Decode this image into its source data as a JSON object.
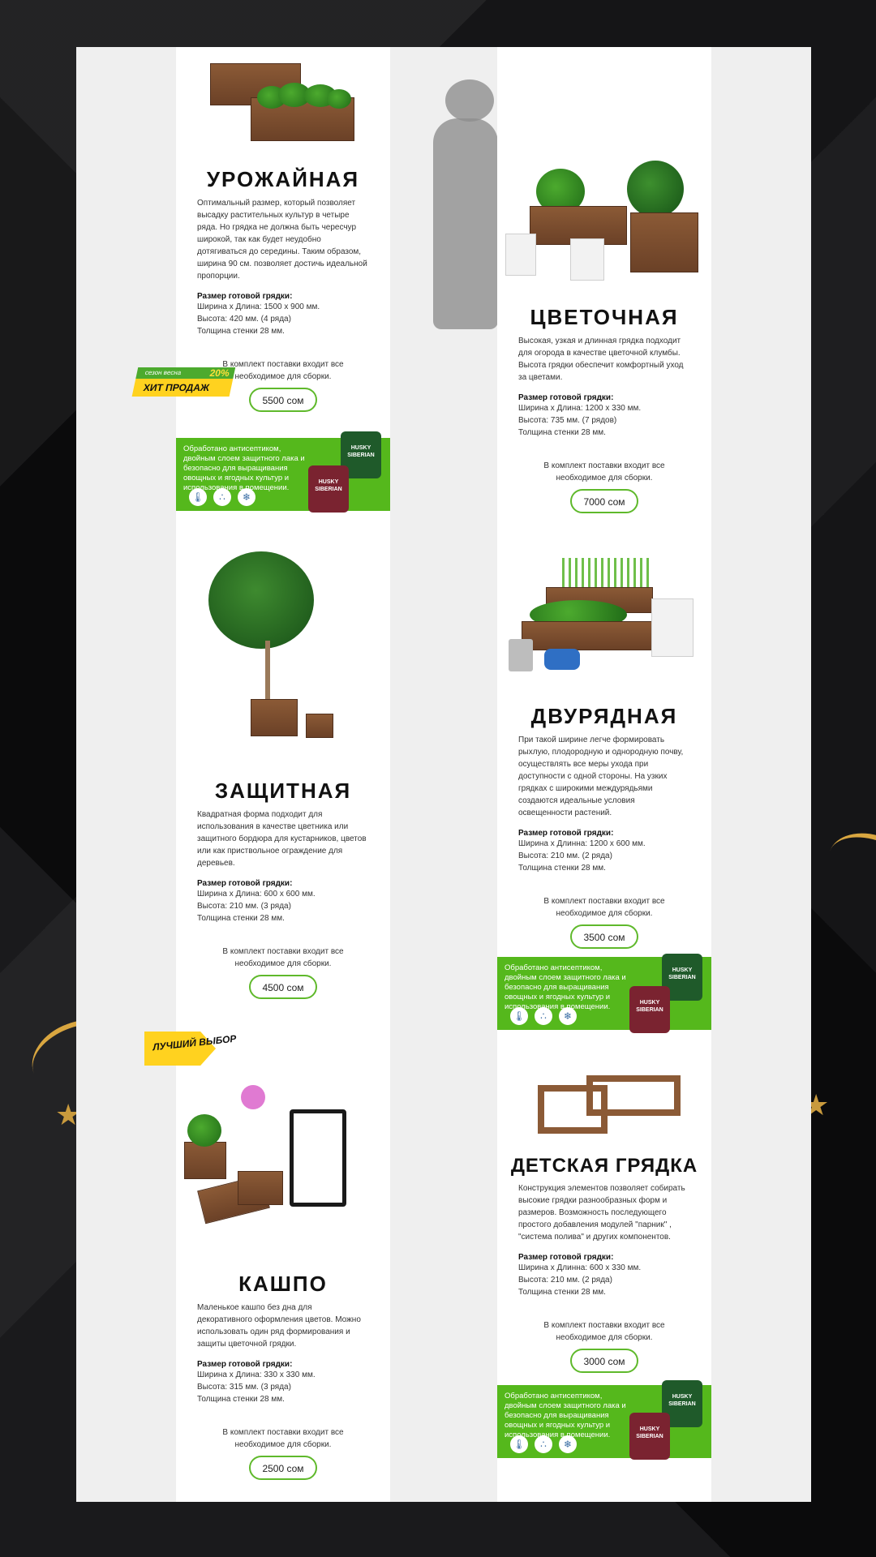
{
  "products": [
    {
      "title": "УРОЖАЙНАЯ",
      "desc": "Оптимальный размер, который позволяет высадку растительных культур в четыре ряда. Но грядка не должна быть чересчур широкой, так как будет неудобно дотягиваться до середины. Таким образом, ширина 90 см. позволяет достичь идеальной пропорции.",
      "size_head": "Размер готовой грядки:",
      "size1": "Ширина х Длина: 1500 х 900 мм.",
      "size2": "Высота: 420 мм. (4 ряда)",
      "size3": "Толщина стенки 28 мм.",
      "kit": "В комплект поставки входит все необходимое для сборки.",
      "price": "5500 сом"
    },
    {
      "title": "ЦВЕТОЧНАЯ",
      "desc": "Высокая, узкая и длинная грядка подходит для огорода в качестве цветочной клумбы. Высота грядки обеспечит комфортный уход за цветами.",
      "size_head": "Размер готовой грядки:",
      "size1": "Ширина х Длина: 1200 х 330 мм.",
      "size2": "Высота: 735 мм. (7 рядов)",
      "size3": "Толщина стенки 28 мм.",
      "kit": "В комплект поставки входит все необходимое для сборки.",
      "price": "7000 сом"
    },
    {
      "title": "ЗАЩИТНАЯ",
      "desc": "Квадратная форма подходит для использования в качестве цветника или защитного бордюра для кустарников, цветов или как приствольное ограждение для деревьев.",
      "size_head": "Размер готовой грядки:",
      "size1": "Ширина х Длина: 600 х 600 мм.",
      "size2": "Высота: 210 мм. (3 ряда)",
      "size3": "Толщина стенки 28 мм.",
      "kit": "В комплект поставки входит все необходимое для сборки.",
      "price": "4500 сом"
    },
    {
      "title": "ДВУРЯДНАЯ",
      "desc": "При такой ширине легче формировать рыхлую, плодородную и однородную почву, осуществлять все меры ухода при доступности с одной стороны. На узких грядках с широкими междурядьями создаются идеальные условия освещенности растений.",
      "size_head": "Размер готовой грядки:",
      "size1": "Ширина х Длинна: 1200 х 600 мм.",
      "size2": "Высота: 210 мм. (2 ряда)",
      "size3": "Толщина стенки 28 мм.",
      "kit": "В комплект поставки входит все необходимое для сборки.",
      "price": "3500 сом"
    },
    {
      "title": "КАШПО",
      "desc": "Маленькое кашпо без дна для декоративного оформления цветов. Можно использовать один ряд формирования и защиты цветочной грядки.",
      "size_head": "Размер готовой грядки:",
      "size1": "Ширина х Длина: 330 х 330 мм.",
      "size2": "Высота: 315 мм. (3 ряда)",
      "size3": "Толщина стенки 28 мм.",
      "kit": "В комплект поставки входит все необходимое для сборки.",
      "price": "2500 сом"
    },
    {
      "title": "ДЕТСКАЯ ГРЯДКА",
      "desc": "Конструкция элементов позволяет собирать высокие грядки разнообразных форм и размеров. Возможность последующего простого добавления модулей \"парник\" , \"система полива\" и других компонентов.",
      "size_head": "Размер готовой грядки:",
      "size1": "Ширина х Длинна: 600 х 330 мм.",
      "size2": "Высота: 210 мм. (2 ряда)",
      "size3": "Толщина стенки 28 мм.",
      "kit": "В комплект поставки входит все необходимое для сборки.",
      "price": "3000 сом"
    }
  ],
  "banner": {
    "text": "Обработано антисептиком, двойным слоем защитного лака и безопасно для выращивания овощных и ягодных культур и использования в помещении.",
    "can1": "HUSKY SIBERIAN",
    "can2": "HUSKY SIBERIAN"
  },
  "badges": {
    "hit_top": "сезон весна",
    "hit_pct": "20%",
    "hit_bottom": "ХИТ ПРОДАЖ",
    "best": "ЛУЧШИЙ ВЫБОР"
  },
  "colors": {
    "accent": "#55b81c",
    "price_border": "#5fb92b",
    "badge_yellow": "#ffd21f"
  }
}
